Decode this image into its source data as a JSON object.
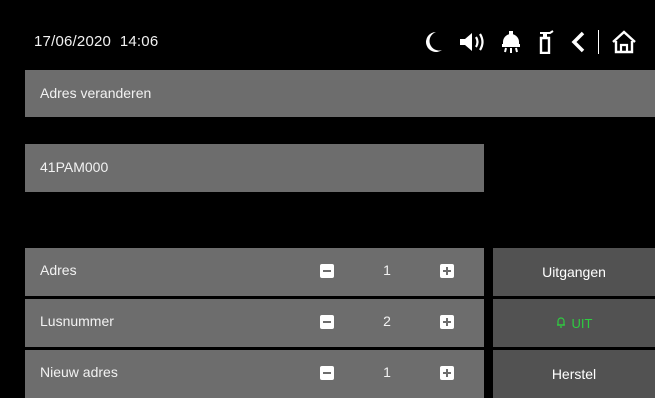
{
  "header": {
    "date": "17/06/2020",
    "time": "14:06",
    "icons": [
      "moon-icon",
      "speaker-icon",
      "fire-detector-icon",
      "extinguisher-icon",
      "back-icon",
      "home-icon"
    ]
  },
  "title": "Adres veranderen",
  "device": "41PAM000",
  "rows": [
    {
      "label": "Adres",
      "value": "1"
    },
    {
      "label": "Lusnummer",
      "value": "2"
    },
    {
      "label": "Nieuw adres",
      "value": "1"
    }
  ],
  "side_buttons": {
    "outputs": "Uitgangen",
    "uit": "UIT",
    "reset": "Herstel"
  },
  "colors": {
    "panel": "#6d6d6d",
    "button": "#525252",
    "uit_green": "#2ecc40"
  }
}
